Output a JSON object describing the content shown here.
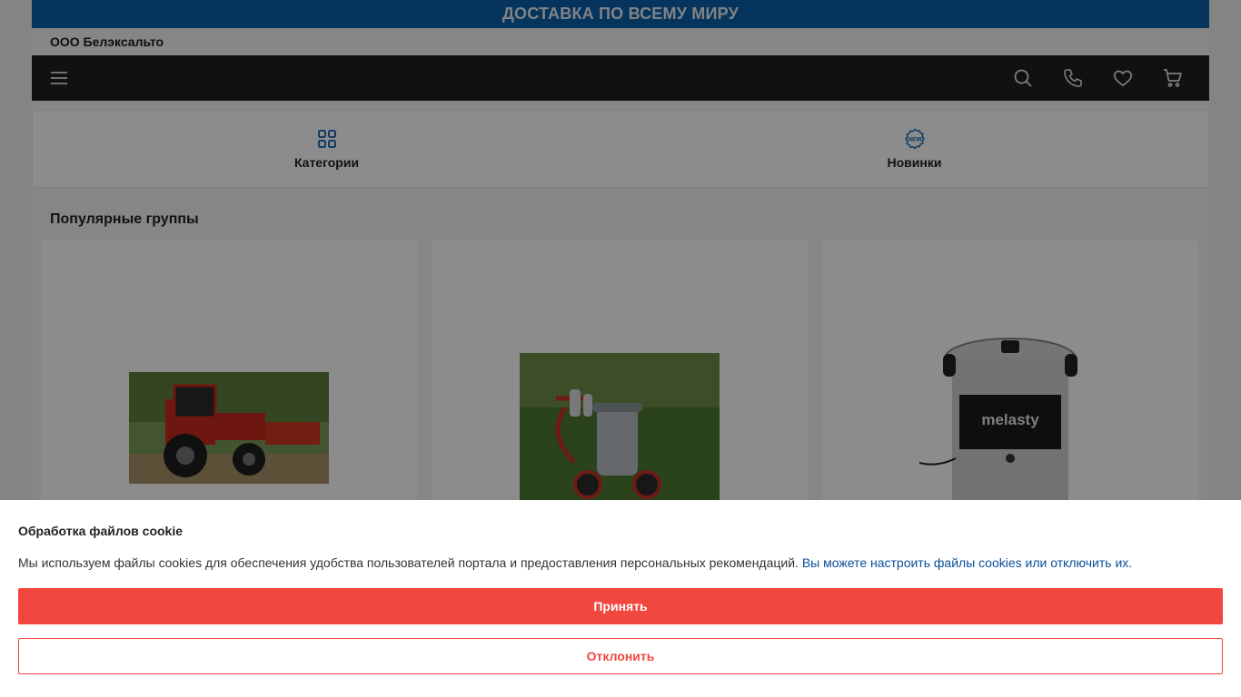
{
  "promo": {
    "text": "ДОСТАВКА ПО ВСЕМУ МИРУ"
  },
  "company": {
    "name": "ООО Белэксальто"
  },
  "navbar": {
    "icons": [
      "menu-icon",
      "search-icon",
      "phone-icon",
      "heart-icon",
      "cart-icon"
    ]
  },
  "quick_links": [
    {
      "label": "Категории",
      "icon": "grid-icon"
    },
    {
      "label": "Новинки",
      "icon": "new-badge-icon"
    }
  ],
  "popular": {
    "title": "Популярные группы",
    "cards": [
      {
        "image": "red-tractor"
      },
      {
        "image": "milking-machine"
      },
      {
        "image": "churning-machine",
        "brand_text": "melasty"
      }
    ]
  },
  "colors": {
    "promo_bg": "#0a5fa8",
    "navbar_bg": "#1f1f1f",
    "accent_red": "#f2473f",
    "link_blue": "#0a4f9a"
  },
  "cookie": {
    "title": "Обработка файлов cookie",
    "text": "Мы используем файлы cookies для обеспечения удобства пользователей портала и предоставления персональных рекомендаций.",
    "link": "Вы можете настроить файлы cookies или отключить их.",
    "accept": "Принять",
    "decline": "Отклонить"
  }
}
